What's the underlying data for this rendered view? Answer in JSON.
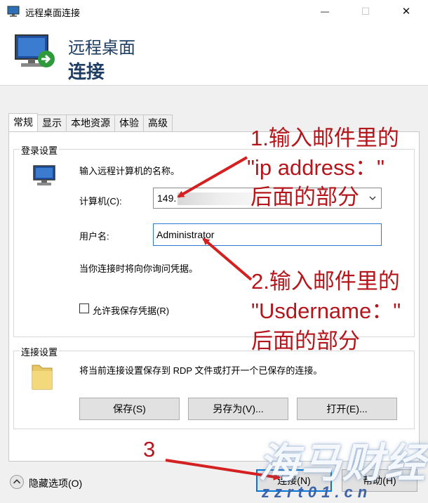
{
  "window": {
    "title": "远程桌面连接",
    "minimize_symbol": "—",
    "maximize_symbol": "☐",
    "close_symbol": "✕",
    "icons": [
      "rdp-app-icon",
      "minimize-icon",
      "maximize-icon",
      "close-icon"
    ]
  },
  "banner": {
    "line1": "远程桌面",
    "line2": "连接",
    "icon": "rdp-monitor-icon"
  },
  "tabs": [
    {
      "label": "常规",
      "active": true
    },
    {
      "label": "显示",
      "active": false
    },
    {
      "label": "本地资源",
      "active": false
    },
    {
      "label": "体验",
      "active": false
    },
    {
      "label": "高级",
      "active": false
    }
  ],
  "login": {
    "group_title": "登录设置",
    "description": "输入远程计算机的名称。",
    "computer_label": "计算机(C):",
    "computer_value": "149.",
    "username_label": "用户名:",
    "username_value": "Administrator",
    "credentials_hint": "当你连接时将向你询问凭据。",
    "save_credentials_label": "允许我保存凭据(R)",
    "icon": "computer-icon"
  },
  "connection": {
    "group_title": "连接设置",
    "description": "将当前连接设置保存到 RDP 文件或打开一个已保存的连接。",
    "save_label": "保存(S)",
    "save_as_label": "另存为(V)...",
    "open_label": "打开(E)...",
    "icon": "folder-icon"
  },
  "footer": {
    "hide_options_label": "隐藏选项(O)",
    "connect_label": "连接(N)",
    "help_label": "帮助(H)",
    "icon": "chevron-up-icon"
  },
  "annotations": {
    "step1_line1": "1.输入邮件里的",
    "step1_line2": "\"ip address：\"",
    "step1_line3": "后面的部分",
    "step2_line1": "2.输入邮件里的",
    "step2_line2": "\"Usdername：\"",
    "step2_line3": "后面的部分",
    "step3": "3",
    "color": "#b5161b"
  },
  "watermark": {
    "brand": "海马财经",
    "domain": "zzrt01.cn"
  }
}
